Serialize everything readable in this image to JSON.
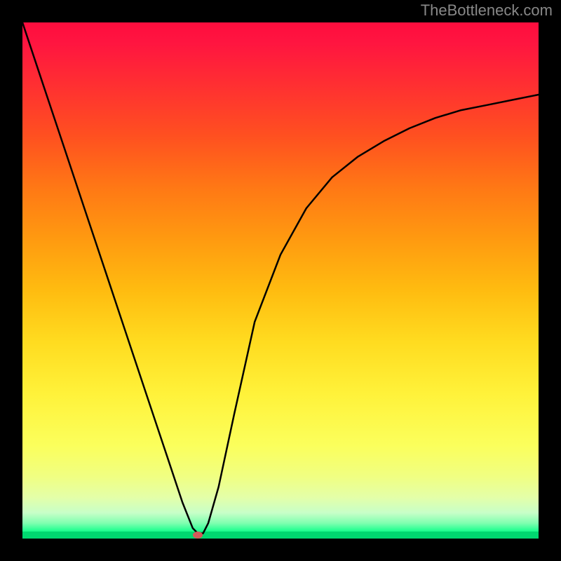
{
  "watermark": "TheBottleneck.com",
  "chart_data": {
    "type": "line",
    "title": "",
    "xlabel": "",
    "ylabel": "",
    "xlim": [
      0,
      100
    ],
    "ylim": [
      0,
      100
    ],
    "grid": false,
    "legend": false,
    "background": {
      "type": "vertical-gradient",
      "stops": [
        {
          "pos": 0,
          "color": "#ff0d3e"
        },
        {
          "pos": 50,
          "color": "#ffbc10"
        },
        {
          "pos": 85,
          "color": "#f0ff82"
        },
        {
          "pos": 100,
          "color": "#00d870"
        }
      ]
    },
    "series": [
      {
        "name": "bottleneck-curve",
        "color": "#000000",
        "x": [
          0,
          4,
          8,
          12,
          16,
          20,
          24,
          28,
          31,
          33,
          34,
          34.5,
          35,
          36,
          38,
          41,
          45,
          50,
          55,
          60,
          65,
          70,
          75,
          80,
          85,
          90,
          95,
          100
        ],
        "values": [
          100,
          88,
          76,
          64,
          52,
          40,
          28,
          16,
          7,
          2,
          1,
          1,
          1,
          3,
          10,
          24,
          42,
          55,
          64,
          70,
          74,
          77,
          79.5,
          81.5,
          83,
          84,
          85,
          86
        ]
      }
    ],
    "marker": {
      "name": "optimal-point",
      "x": 34,
      "y": 0.7,
      "color": "#d45a5a"
    }
  }
}
